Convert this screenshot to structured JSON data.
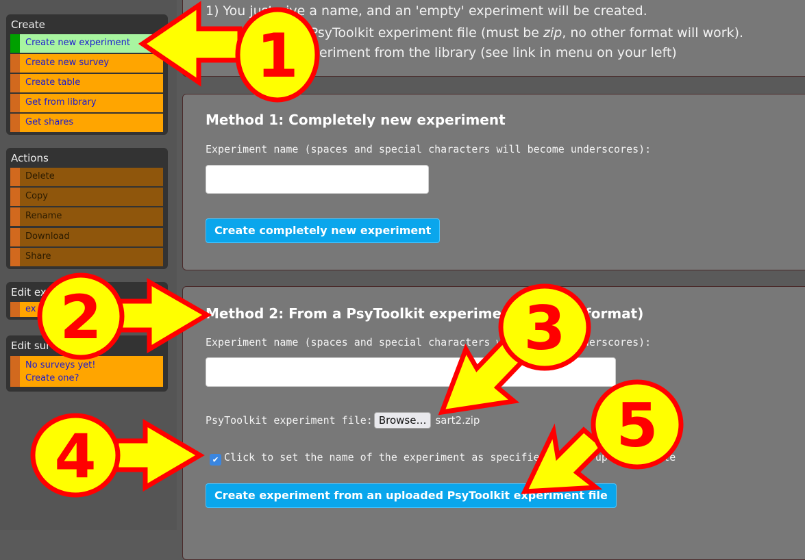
{
  "sidebar": {
    "create": {
      "title": "Create",
      "items": [
        "Create new experiment",
        "Create new survey",
        "Create table",
        "Get from library",
        "Get shares"
      ]
    },
    "actions": {
      "title": "Actions",
      "items": [
        "Delete",
        "Copy",
        "Rename",
        "Download",
        "Share"
      ]
    },
    "edit_experiments": {
      "title": "Edit experiments",
      "items": [
        "ex"
      ]
    },
    "edit_surveys": {
      "title": "Edit surveys",
      "line1": "No surveys yet!",
      "line2": "Create one?"
    }
  },
  "intro": {
    "line1": "1) You just give a name, and an 'empty' experiment will be created.",
    "line2a": "2) You upload a PsyToolkit experiment file (must be ",
    "line2em": "zip",
    "line2b": ", no other format will work).",
    "line3": "3) You get an experiment from the library (see link in menu on your left)"
  },
  "method1": {
    "heading": "Method 1: Completely new experiment",
    "label": "Experiment name (spaces and special characters will become underscores):",
    "input_value": "",
    "button": "Create completely new experiment"
  },
  "method2": {
    "heading": "Method 2: From a PsyToolkit experiment file (zip format)",
    "label": "Experiment name (spaces and special characters will become underscores):",
    "input_value": "",
    "file_label": "PsyToolkit experiment file:",
    "browse": "Browse…",
    "file_name": "sart2.zip",
    "checkbox_checked": true,
    "checkbox_label": "Click to set the name of the experiment as specified in the uploaded file",
    "button": "Create experiment from an uploaded PsyToolkit experiment file"
  },
  "annotations": {
    "n1": "1",
    "n2": "2",
    "n3": "3",
    "n4": "4",
    "n5": "5",
    "fill": "#ffff00",
    "stroke": "#ff0000"
  },
  "colors": {
    "menu_item": "#ffa500",
    "menu_selected": "#a8f5a0",
    "button": "#0aa6ec"
  }
}
